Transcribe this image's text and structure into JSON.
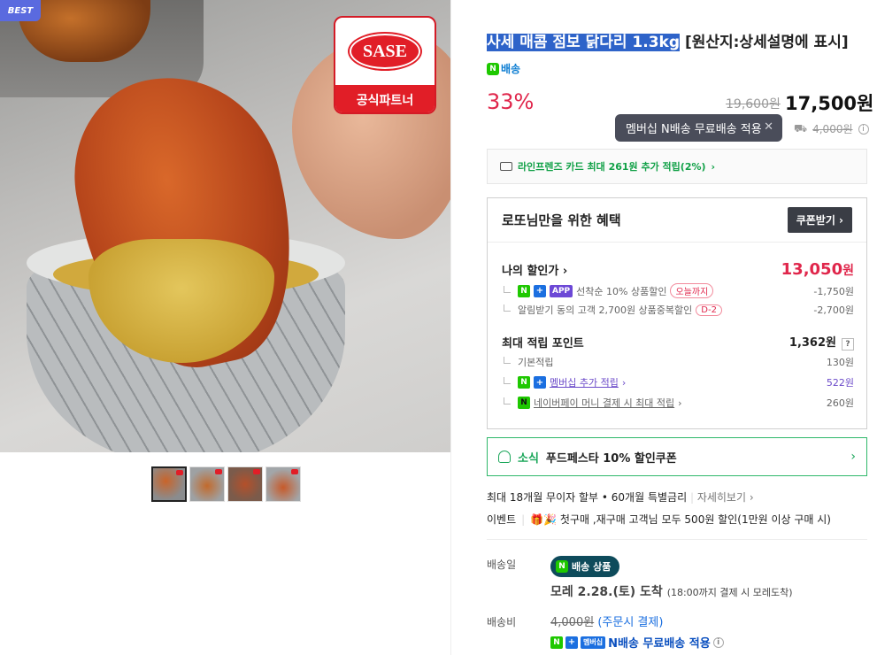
{
  "image": {
    "best_badge": "BEST",
    "brand_logo_text": "SASE",
    "brand_partner_label": "공식파트너"
  },
  "product": {
    "title_selected": "사세 매콤 점보 닭다리 1.3kg",
    "title_rest": " [원산지:상세설명에 표시]",
    "delivery_badge": "배송",
    "discount_rate": "33%",
    "original_price": "19,600원",
    "sale_price": "17,500원"
  },
  "tooltip": {
    "text": "멤버십 N배송 무료배송 적용",
    "shipping_strike": "4,000원"
  },
  "card_promo": "라인프렌즈 카드 최대 261원 추가 적립(2%)",
  "benefit": {
    "title": "로또님만을 위한 혜택",
    "coupon_button": "쿠폰받기",
    "my_price_label": "나의 할인가",
    "my_price_value": "13,050",
    "my_price_unit": "원",
    "discounts": [
      {
        "text": "선착순 10% 상품할인",
        "tag": "오늘까지",
        "amount": "-1,750원"
      },
      {
        "text": "알림받기 동의 고객 2,700원 상품중복할인",
        "tag": "D-2",
        "amount": "-2,700원"
      }
    ],
    "points_label": "최대 적립 포인트",
    "points_value": "1,362원",
    "points": [
      {
        "text": "기본적립",
        "amount": "130원"
      },
      {
        "text": "멤버십 추가 적립",
        "amount": "522원"
      },
      {
        "text": "네이버페이 머니 결제 시 최대 적립",
        "amount": "260원"
      }
    ],
    "app_label": "APP"
  },
  "news": {
    "tag": "소식",
    "text": "푸드페스타 10% 할인쿠폰"
  },
  "installment": {
    "text": "최대 18개월 무이자 할부 • 60개월 특별금리",
    "more": "자세히보기"
  },
  "event": {
    "label": "이벤트",
    "text": "첫구매 ,재구매 고객님 모두 500원 할인(1만원 이상 구매 시)"
  },
  "delivery": {
    "label": "배송일",
    "chip": "배송 상품",
    "date": "모레 2.28.(토) 도착",
    "note": "(18:00까지 결제 시 모레도착)"
  },
  "fee": {
    "label": "배송비",
    "amount": "4,000원",
    "pay": "(주문시 결제)",
    "member_label": "멤버십",
    "member_text": "N배송 무료배송 적용"
  }
}
